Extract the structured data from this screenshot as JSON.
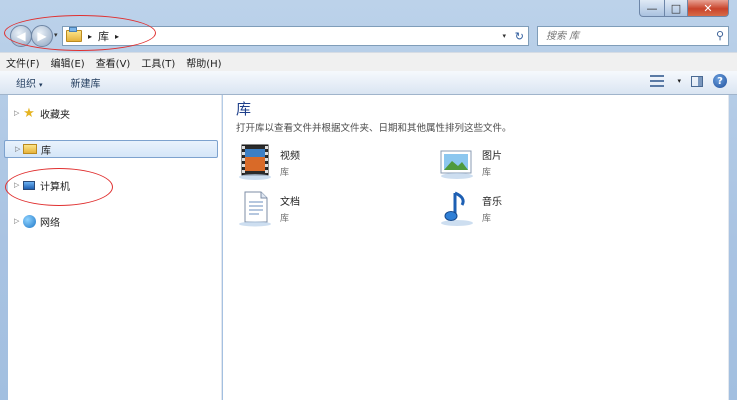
{
  "window": {
    "caption_min": "—",
    "caption_max": "□",
    "caption_close": "✕"
  },
  "address": {
    "back_glyph": "◀",
    "forward_glyph": "▶",
    "recent_glyph": "▾",
    "separator": "▸",
    "path": [
      "库"
    ],
    "dropdown_glyph": "▾",
    "refresh_glyph": "↻"
  },
  "search": {
    "placeholder": "搜索 库",
    "icon": "search-icon"
  },
  "menu": [
    "文件(F)",
    "编辑(E)",
    "查看(V)",
    "工具(T)",
    "帮助(H)"
  ],
  "toolbar": {
    "organize": "组织",
    "dropdown_glyph": "▾",
    "new_library": "新建库",
    "help_glyph": "?"
  },
  "nav": {
    "items": [
      {
        "label": "收藏夹",
        "icon": "star-icon"
      },
      {
        "label": "库",
        "icon": "library-icon",
        "selected": true
      },
      {
        "label": "计算机",
        "icon": "computer-icon"
      },
      {
        "label": "网络",
        "icon": "network-icon"
      }
    ],
    "expander_glyph": "▷"
  },
  "content": {
    "title": "库",
    "subtitle": "打开库以查看文件并根据文件夹、日期和其他属性排列这些文件。",
    "libraries": [
      {
        "name": "视频",
        "type": "库",
        "icon": "video-library-icon"
      },
      {
        "name": "图片",
        "type": "库",
        "icon": "pictures-library-icon"
      },
      {
        "name": "文档",
        "type": "库",
        "icon": "documents-library-icon"
      },
      {
        "name": "音乐",
        "type": "库",
        "icon": "music-library-icon"
      }
    ]
  },
  "colors": {
    "title_blue": "#1e3f8a",
    "annotation_red": "#e03030",
    "frame": "#a9c3e2"
  }
}
